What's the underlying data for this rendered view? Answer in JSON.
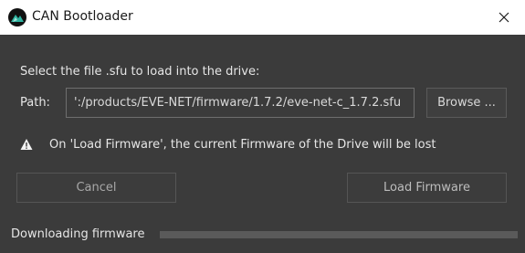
{
  "window": {
    "title": "CAN Bootloader",
    "close_symbol": "✕"
  },
  "form": {
    "instruction": "Select the file .sfu to load into the drive:",
    "path_label": "Path:",
    "path_value": "':/products/EVE-NET/firmware/1.7.2/eve-net-c_1.7.2.sfu",
    "browse_label": "Browse ..."
  },
  "warning": {
    "icon": "warning-triangle-icon",
    "text": "On 'Load Firmware', the current Firmware of the Drive will be lost"
  },
  "actions": {
    "cancel_label": "Cancel",
    "load_label": "Load Firmware"
  },
  "status": {
    "text": "Downloading firmware",
    "progress": 0
  },
  "colors": {
    "background": "#3b3b3b",
    "titlebar": "#ffffff",
    "text": "#e6e6e6",
    "disabled_text": "#a8a8a8",
    "accent_icon": "#2fb3a0"
  }
}
